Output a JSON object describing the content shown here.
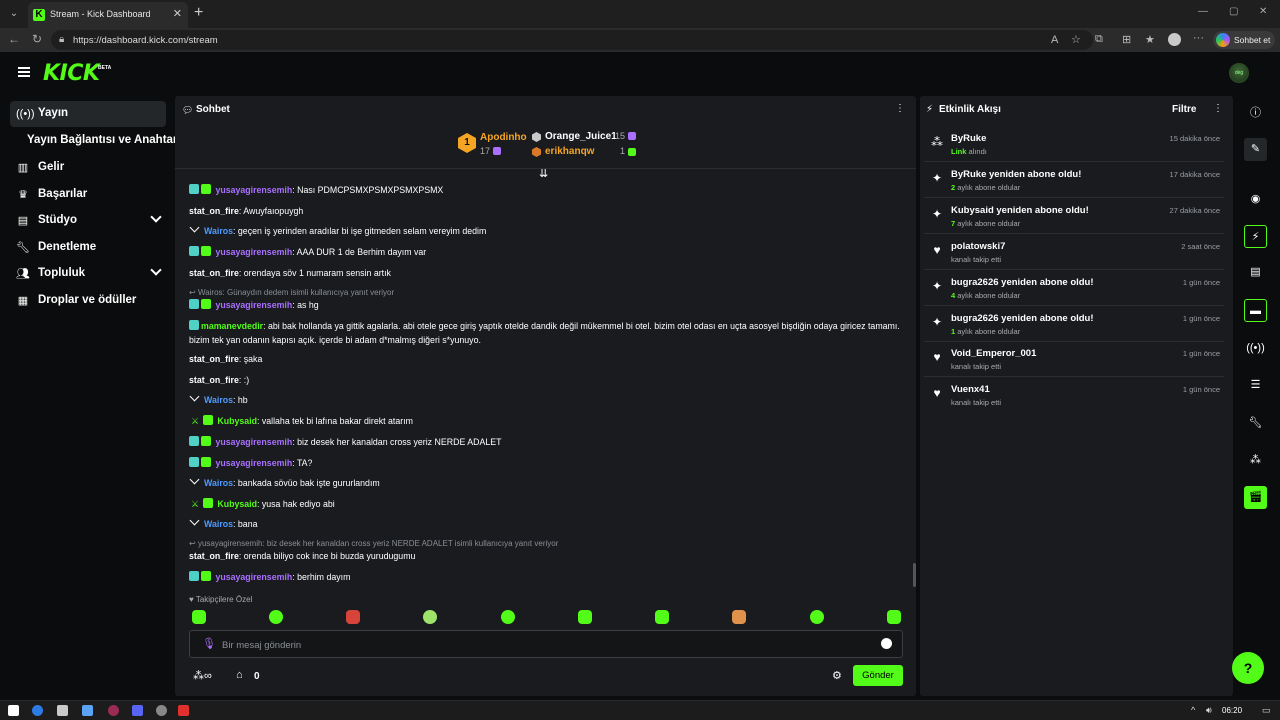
{
  "browser": {
    "tab_title": "Stream - Kick Dashboard",
    "url": "https://dashboard.kick.com/stream",
    "copilot_label": "Sohbet et"
  },
  "app": {
    "logo": "KICK",
    "beta": "BETA",
    "avatar_text": "deg"
  },
  "sidebar": {
    "items": [
      {
        "label": "Yayın",
        "icon": "broadcast-icon"
      },
      {
        "label": "Yayın Bağlantısı ve Anahtarı"
      },
      {
        "label": "Gelir",
        "icon": "chart-icon"
      },
      {
        "label": "Başarılar",
        "icon": "trophy-icon"
      },
      {
        "label": "Stüdyo",
        "icon": "layout-icon"
      },
      {
        "label": "Denetleme",
        "icon": "wrench-icon"
      },
      {
        "label": "Topluluk",
        "icon": "community-icon"
      },
      {
        "label": "Droplar ve ödüller",
        "icon": "gift-icon"
      }
    ]
  },
  "chat": {
    "title": "Sohbet",
    "top_gifters": {
      "first": {
        "name": "Apodinho",
        "count": "17",
        "rank": "1"
      },
      "second": {
        "name": "Orange_Juice1",
        "count": "15"
      },
      "third": {
        "name": "erikhanqw",
        "count": "1"
      }
    },
    "messages": [
      {
        "user": "yusayagirensemih",
        "text": ": Nası PDMCPSMXPSMXPSMXPSMX"
      },
      {
        "user": "stat_on_fire",
        "text": ": Awuyfaıopuygh"
      },
      {
        "user": "Wairos",
        "text": ": geçen iş yerinden aradılar bi işe gitmeden selam vereyim dedim"
      },
      {
        "user": "yusayagirensemih",
        "text": ": AAA DUR 1 de Berhim dayım var"
      },
      {
        "user": "stat_on_fire",
        "text": ": orendaya söv 1 numaram sensin artık"
      },
      {
        "user": "yusayagirensemih",
        "text": ": as hg"
      },
      {
        "user": "mamanevdedir",
        "text": ": abi bak hollanda ya gittik agalarla. abi otele gece giriş yaptık otelde dandik değil mükemmel bi otel. bizim otel odası en uçta asosyel bişdiğin odaya giricez tamamı. bizim tek yan odanın kapısı açık. içerde bi adam d*malmış diğeri s*yunuyo."
      },
      {
        "user": "stat_on_fire",
        "text": ": şaka"
      },
      {
        "user": "stat_on_fire",
        "text": ": :)"
      },
      {
        "user": "Wairos",
        "text": ": hb"
      },
      {
        "user": "Kubysaid",
        "text": ": vallaha tek bi lafına bakar direkt atarım"
      },
      {
        "user": "yusayagirensemih",
        "text": ": biz desek her kanaldan cross yeriz NERDE ADALET"
      },
      {
        "user": "yusayagirensemih",
        "text": ": TA?"
      },
      {
        "user": "Wairos",
        "text": ": bankada sövüo bak işte gururlandım"
      },
      {
        "user": "Kubysaid",
        "text": ": yusa hak ediyo abi"
      },
      {
        "user": "Wairos",
        "text": ": bana"
      },
      {
        "user": "stat_on_fire",
        "text": ": orenda biliyo cok ince bi buzda yurudugumu"
      },
      {
        "user": "yusayagirensemih",
        "text": ": berhim dayım"
      }
    ],
    "replies": [
      "Wairos: Günaydın dedem isimli kullanıcıya yanıt veriyor",
      "yusayagirensemih: biz desek her kanaldan cross yeriz NERDE ADALET isimli kullanıcıya yanıt veriyor"
    ],
    "emote_label": "Takipçilere Özel",
    "input_placeholder": "Bir mesaj gönderin",
    "points_value": "0",
    "send_label": "Gönder",
    "colors": {
      "purple": "#a970ff",
      "green": "#53fc18",
      "blue": "#4f9bff"
    }
  },
  "feed": {
    "title": "Etkinlik Akışı",
    "filter_label": "Filtre",
    "events": [
      {
        "title": "ByRuke",
        "sub_hl": "Link",
        "sub": " alındı",
        "time": "15 dakika önce",
        "icon": "link-icon"
      },
      {
        "title": "ByRuke yeniden abone oldu!",
        "sub_hl": "2",
        "sub": " aylık abone oldular",
        "time": "17 dakika önce",
        "icon": "sparkle-icon"
      },
      {
        "title": "Kubysaid yeniden abone oldu!",
        "sub_hl": "7",
        "sub": " aylık abone oldular",
        "time": "27 dakika önce",
        "icon": "sparkle-icon"
      },
      {
        "title": "polatowski7",
        "sub_hl": "",
        "sub": "kanalı takip etti",
        "time": "2 saat önce",
        "icon": "heart-icon"
      },
      {
        "title": "bugra2626 yeniden abone oldu!",
        "sub_hl": "4",
        "sub": " aylık abone oldular",
        "time": "1 gün önce",
        "icon": "sparkle-icon"
      },
      {
        "title": "bugra2626 yeniden abone oldu!",
        "sub_hl": "1",
        "sub": " aylık abone oldular",
        "time": "1 gün önce",
        "icon": "sparkle-icon"
      },
      {
        "title": "Void_Emperor_001",
        "sub_hl": "",
        "sub": "kanalı takip etti",
        "time": "1 gün önce",
        "icon": "heart-icon"
      },
      {
        "title": "Vuenx41",
        "sub_hl": "",
        "sub": "kanalı takip etti",
        "time": "1 gün önce",
        "icon": "heart-icon"
      }
    ]
  },
  "taskbar": {
    "time": "06:20"
  }
}
